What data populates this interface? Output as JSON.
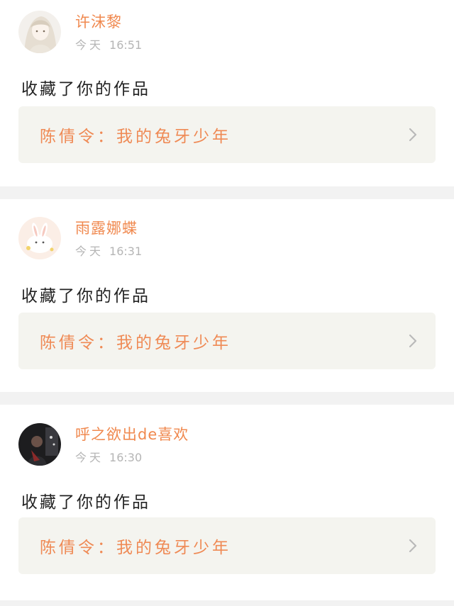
{
  "notifications": [
    {
      "username": "许沫黎",
      "time_day": "今天",
      "time_clock": "16:51",
      "action": "收藏了你的作品",
      "work_title": "陈倩令：我的兔牙少年",
      "avatar": "anime-girl-avatar"
    },
    {
      "username": "雨露娜蝶",
      "time_day": "今天",
      "time_clock": "16:31",
      "action": "收藏了你的作品",
      "work_title": "陈倩令：我的兔牙少年",
      "avatar": "white-rabbit-avatar"
    },
    {
      "username": "呼之欲出de喜欢",
      "time_day": "今天",
      "time_clock": "16:30",
      "action": "收藏了你的作品",
      "work_title": "陈倩令：我的兔牙少年",
      "avatar": "dark-photo-avatar"
    }
  ],
  "colors": {
    "username": "#f0894f",
    "work_title": "#ef8a55",
    "time": "#b5b5b5",
    "card_link_bg": "#f4f4ef",
    "page_bg": "#f2f2f2"
  },
  "icons": {
    "chevron": "chevron-right-icon"
  }
}
